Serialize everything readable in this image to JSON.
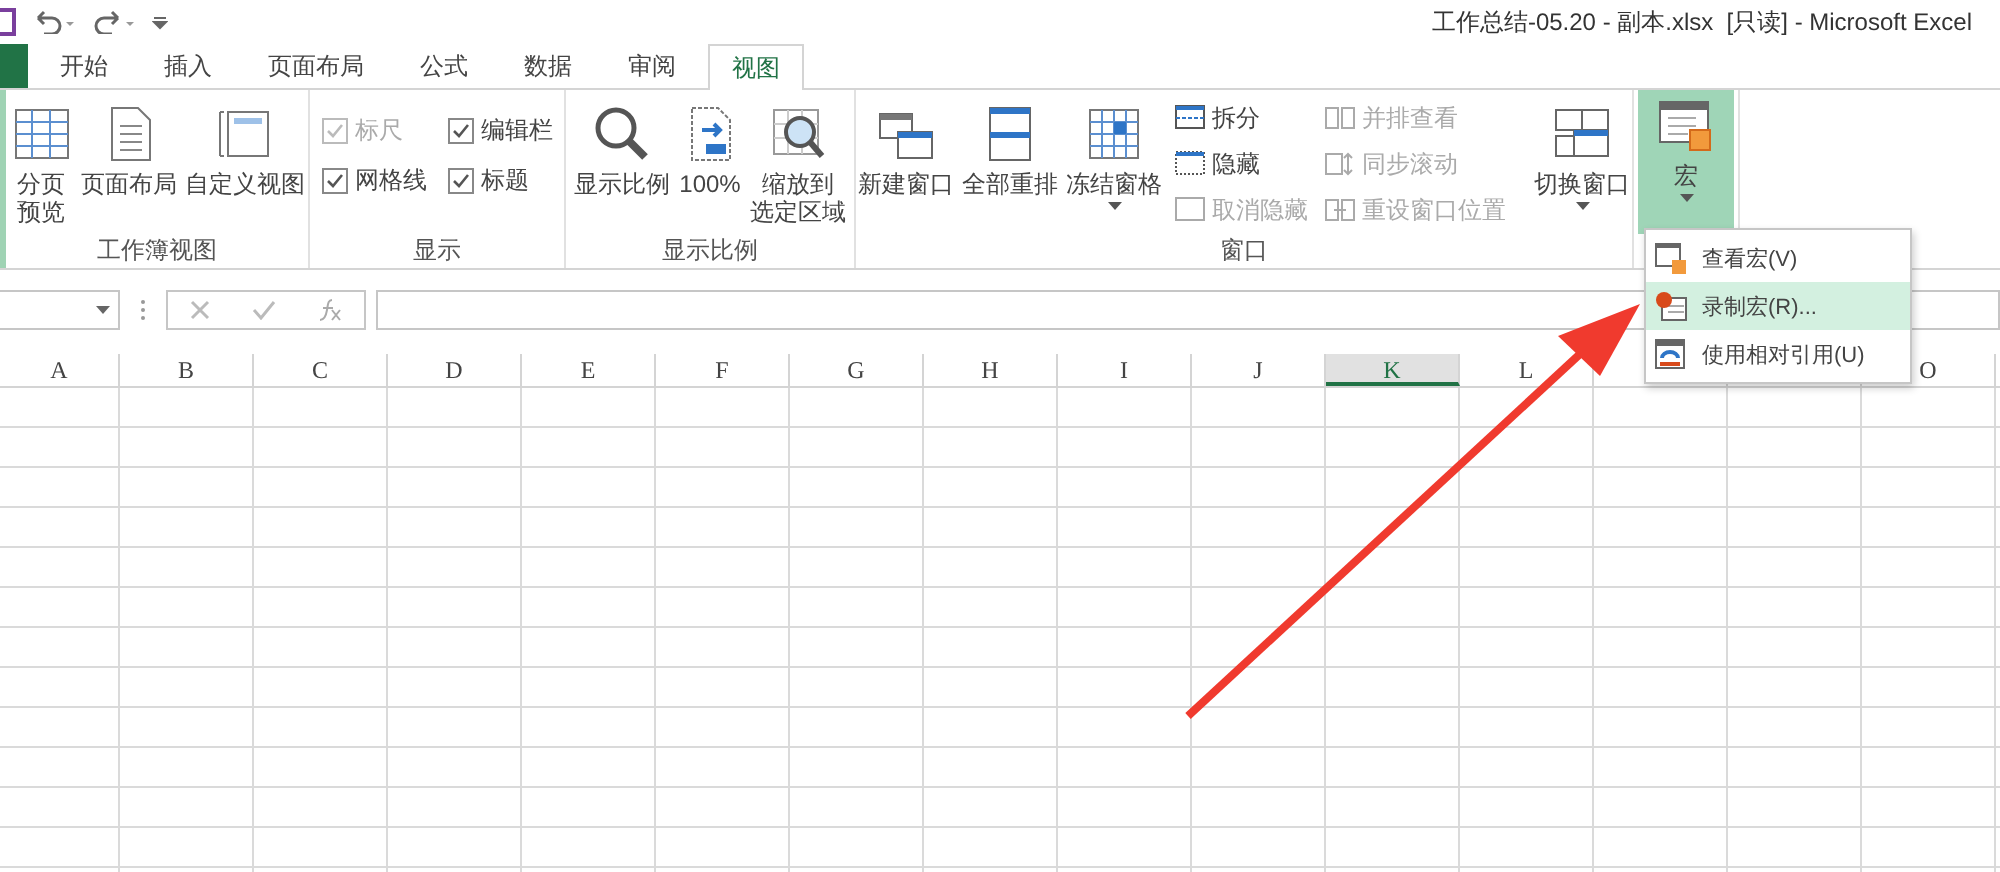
{
  "window": {
    "title": "工作总结-05.20 - 副本.xlsx  [只读] - Microsoft Excel"
  },
  "tabs": [
    {
      "label": "开始",
      "selected": false
    },
    {
      "label": "插入",
      "selected": false
    },
    {
      "label": "页面布局",
      "selected": false
    },
    {
      "label": "公式",
      "selected": false
    },
    {
      "label": "数据",
      "selected": false
    },
    {
      "label": "审阅",
      "selected": false
    },
    {
      "label": "视图",
      "selected": true
    }
  ],
  "ribbon": {
    "groups": [
      {
        "label": "工作簿视图",
        "items": [
          {
            "kind": "large",
            "label": [
              "分页",
              "预览"
            ]
          },
          {
            "kind": "large",
            "label": "页面布局"
          },
          {
            "kind": "large",
            "label": "自定义视图"
          }
        ]
      },
      {
        "label": "显示",
        "items": [
          {
            "kind": "check",
            "label": "标尺",
            "checked": true,
            "disabled": true
          },
          {
            "kind": "check",
            "label": "编辑栏",
            "checked": true,
            "disabled": false
          },
          {
            "kind": "check",
            "label": "网格线",
            "checked": true,
            "disabled": false
          },
          {
            "kind": "check",
            "label": "标题",
            "checked": true,
            "disabled": false
          }
        ]
      },
      {
        "label": "显示比例",
        "items": [
          {
            "kind": "large",
            "label": "显示比例"
          },
          {
            "kind": "large",
            "label": "100%"
          },
          {
            "kind": "large",
            "label": [
              "缩放到",
              "选定区域"
            ]
          }
        ]
      },
      {
        "label": "窗口",
        "items": [
          {
            "kind": "large",
            "label": "新建窗口"
          },
          {
            "kind": "large",
            "label": "全部重排"
          },
          {
            "kind": "large",
            "label": "冻结窗格",
            "dropdown": true
          },
          {
            "kind": "stack",
            "items": [
              {
                "label": "拆分",
                "disabled": false
              },
              {
                "label": "隐藏",
                "disabled": false
              },
              {
                "label": "取消隐藏",
                "disabled": true
              }
            ]
          },
          {
            "kind": "stack",
            "items": [
              {
                "label": "并排查看",
                "disabled": true
              },
              {
                "label": "同步滚动",
                "disabled": true
              },
              {
                "label": "重设窗口位置",
                "disabled": true
              }
            ]
          },
          {
            "kind": "large",
            "label": "切换窗口",
            "dropdown": true
          }
        ]
      },
      {
        "items": [
          {
            "kind": "large",
            "label": "宏",
            "dropdown": true,
            "pressed": true
          }
        ]
      }
    ]
  },
  "columns": [
    {
      "label": "A",
      "selected": false
    },
    {
      "label": "B",
      "selected": false
    },
    {
      "label": "C",
      "selected": false
    },
    {
      "label": "D",
      "selected": false
    },
    {
      "label": "E",
      "selected": false
    },
    {
      "label": "F",
      "selected": false
    },
    {
      "label": "G",
      "selected": false
    },
    {
      "label": "H",
      "selected": false
    },
    {
      "label": "I",
      "selected": false
    },
    {
      "label": "J",
      "selected": false
    },
    {
      "label": "K",
      "selected": true
    },
    {
      "label": "L",
      "selected": false
    },
    {
      "selected": false
    },
    {
      "selected": false
    },
    {
      "label": "O",
      "selected": false
    }
  ],
  "macro_menu": {
    "items": [
      {
        "label": "查看宏(V)",
        "selected": false
      },
      {
        "label": "录制宏(R)...",
        "selected": true
      },
      {
        "label": "使用相对引用(U)",
        "selected": false
      }
    ]
  }
}
